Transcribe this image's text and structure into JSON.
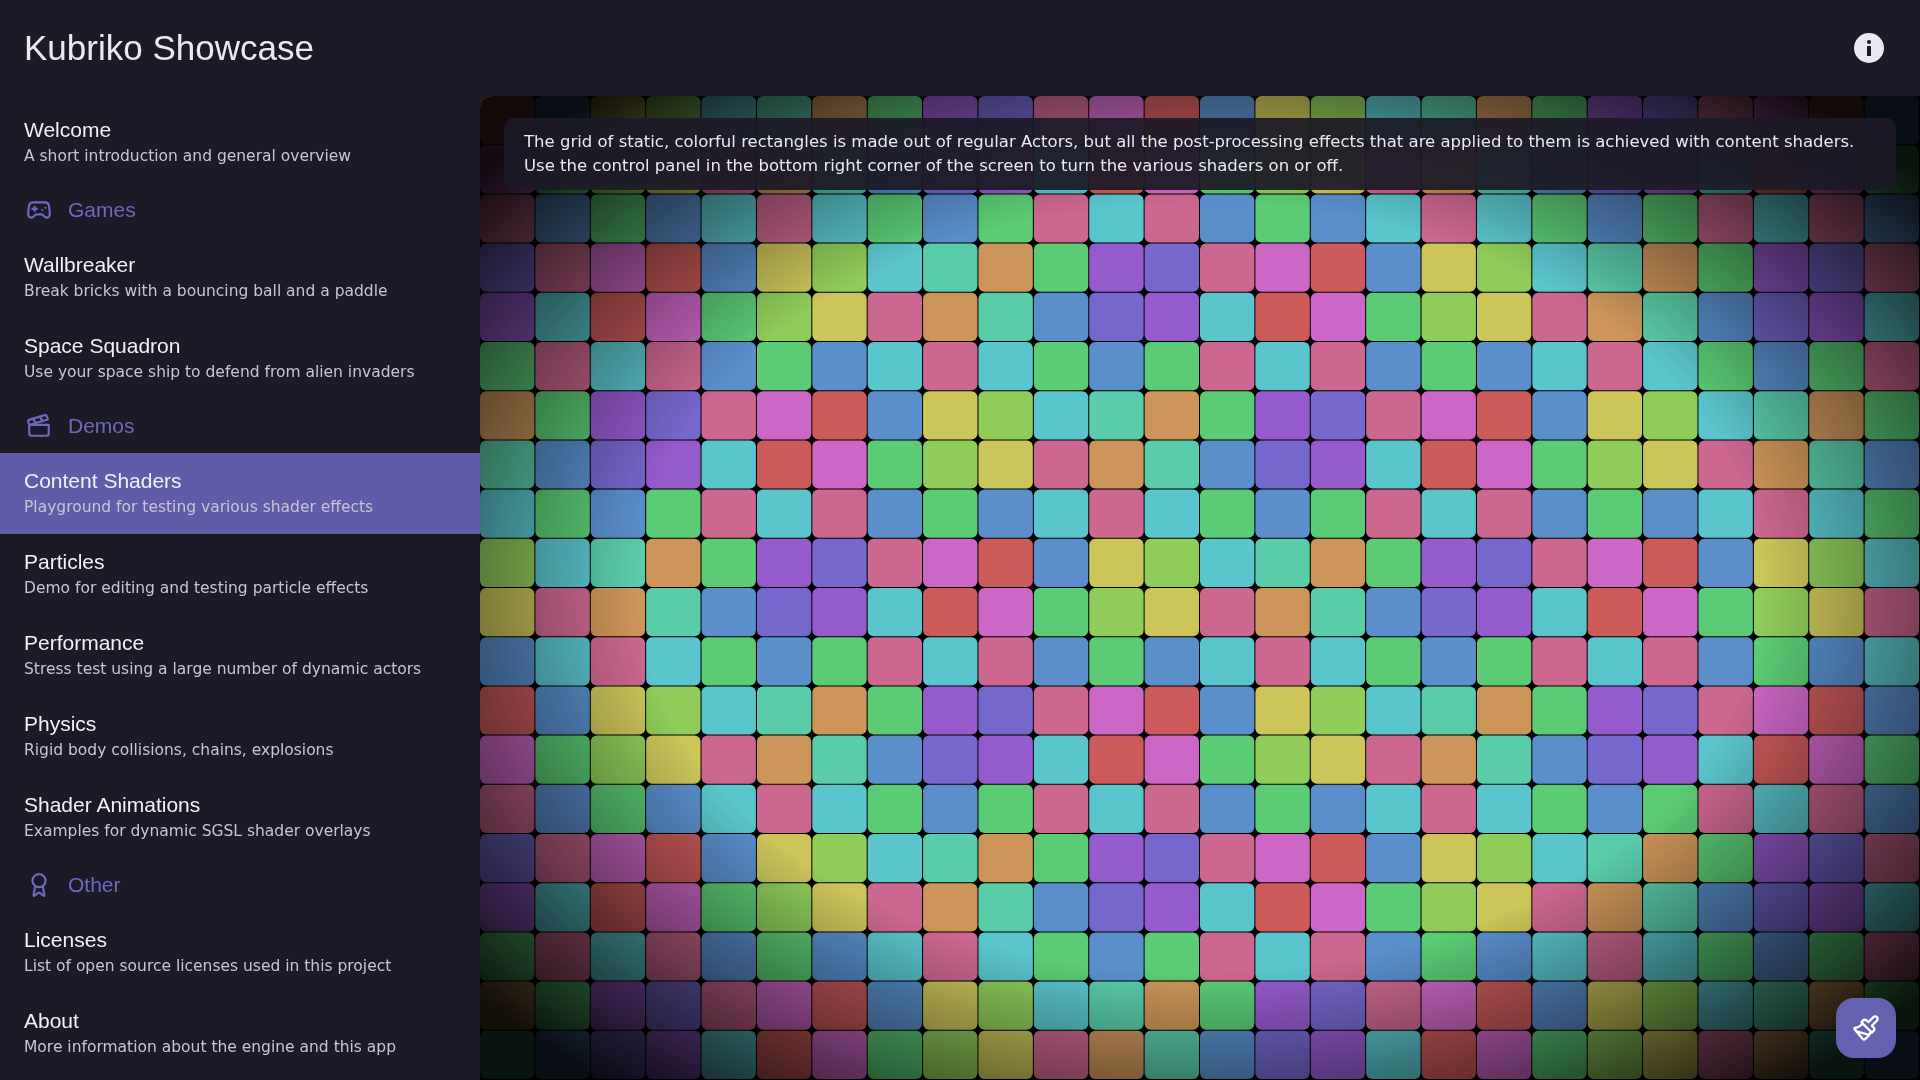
{
  "app": {
    "title": "Kubriko Showcase"
  },
  "sidebar": {
    "entries": [
      {
        "kind": "item",
        "title": "Welcome",
        "subtitle": "A short introduction and general overview",
        "selected": false
      },
      {
        "kind": "section",
        "label": "Games"
      },
      {
        "kind": "item",
        "title": "Wallbreaker",
        "subtitle": "Break bricks with a bouncing ball and a paddle",
        "selected": false
      },
      {
        "kind": "item",
        "title": "Space Squadron",
        "subtitle": "Use your space ship to defend from alien invaders",
        "selected": false
      },
      {
        "kind": "section",
        "label": "Demos"
      },
      {
        "kind": "item",
        "title": "Content Shaders",
        "subtitle": "Playground for testing various shader effects",
        "selected": true
      },
      {
        "kind": "item",
        "title": "Particles",
        "subtitle": "Demo for editing and testing particle effects",
        "selected": false
      },
      {
        "kind": "item",
        "title": "Performance",
        "subtitle": "Stress test using a large number of dynamic actors",
        "selected": false
      },
      {
        "kind": "item",
        "title": "Physics",
        "subtitle": "Rigid body collisions, chains, explosions",
        "selected": false
      },
      {
        "kind": "item",
        "title": "Shader Animations",
        "subtitle": "Examples for dynamic SGSL shader overlays",
        "selected": false
      },
      {
        "kind": "section",
        "label": "Other"
      },
      {
        "kind": "item",
        "title": "Licenses",
        "subtitle": "List of open source licenses used in this project",
        "selected": false
      },
      {
        "kind": "item",
        "title": "About",
        "subtitle": "More information about the engine and this app",
        "selected": false
      }
    ]
  },
  "content": {
    "description": "The grid of static, colorful rectangles is made out of regular Actors, but all the post-processing effects that are applied to them is achieved with content shaders. Use the control panel in the bottom right corner of the screen to turn the various shaders on or off."
  }
}
